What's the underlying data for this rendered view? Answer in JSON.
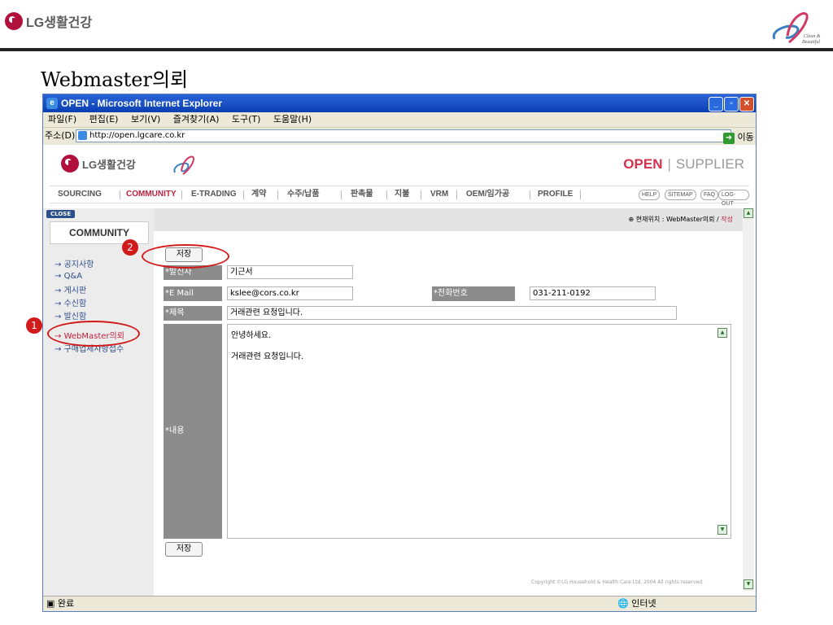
{
  "slide": {
    "brand": "LG생활건강",
    "brand_mark_text": "Clean & Beautiful",
    "title": "Webmaster의뢰"
  },
  "browser": {
    "title": "OPEN - Microsoft Internet Explorer",
    "menu": [
      "파일(F)",
      "편집(E)",
      "보기(V)",
      "즐겨찾기(A)",
      "도구(T)",
      "도움말(H)"
    ],
    "address_label": "주소(D)",
    "address": "http://open.lgcare.co.kr",
    "go_label": "이동",
    "status": "완료",
    "zone": "인터넷"
  },
  "site": {
    "logo": "LG생활건강",
    "open": "OPEN",
    "supplier": "SUPPLIER",
    "nav": [
      "SOURCING",
      "COMMUNITY",
      "E-TRADING",
      "계약",
      "수주/납품",
      "판촉물",
      "지불",
      "VRM",
      "OEM/임가공",
      "PROFILE"
    ],
    "util": [
      "HELP",
      "SITEMAP",
      "FAQ",
      "LOG-OUT"
    ],
    "close": "CLOSE",
    "community": "COMMUNITY",
    "sidebar": [
      "공지사항",
      "Q&A",
      "게시판",
      "수신함",
      "발신함",
      "WebMaster의뢰",
      "구매업체사항접수"
    ],
    "location_label": "현재위치 : WebMaster의뢰 /",
    "location_current": "작성",
    "copyright": "Copyright ©LG Household & Health Care Ltd. 2004 All rights reserved."
  },
  "form": {
    "save": "저장",
    "sender_label": "*발신자",
    "sender": "기근서",
    "email_label": "*E Mail",
    "email": "kslee@cors.co.kr",
    "phone_label": "*전화번호",
    "phone": "031-211-0192",
    "subject_label": "*제목",
    "subject": "거래관련 요청입니다.",
    "content_label": "*내용",
    "content_line1": "안녕하세요.",
    "content_line2": "거래관련 요청입니다."
  },
  "markers": [
    "1",
    "2"
  ],
  "colors": {
    "accent": "#c0213e",
    "marker": "#d11a1a",
    "titlebar": "#0a3fb2"
  }
}
